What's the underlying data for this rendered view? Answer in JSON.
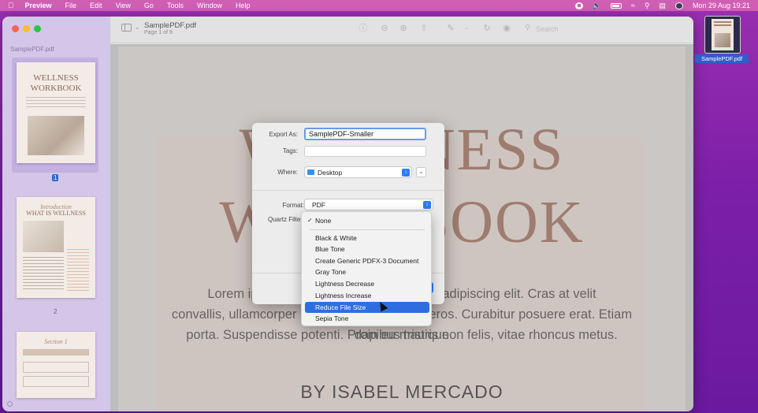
{
  "menubar": {
    "apple": "",
    "app_name": "Preview",
    "items": [
      "File",
      "Edit",
      "View",
      "Go",
      "Tools",
      "Window",
      "Help"
    ],
    "datetime": "Mon 29 Aug  19:21"
  },
  "sidebar": {
    "filename": "SamplePDF.pdf",
    "thumbnails": [
      {
        "title": "WELLNESS WORKBOOK",
        "page": "1"
      },
      {
        "title_script": "Introduction",
        "title": "WHAT IS WELLNESS",
        "page": "2"
      },
      {
        "title_script": "Section 1",
        "title": "",
        "page": ""
      }
    ]
  },
  "toolbar": {
    "title": "SamplePDF.pdf",
    "subtitle": "Page 1 of 9",
    "search_placeholder": "Search"
  },
  "document": {
    "title_line1": "WELLNESS",
    "title_line2": "WORKBOOK",
    "lorem_line1": "Lorem ipsum dolor sit amet, consectetur adipiscing elit. Cras at velit",
    "lorem_line2": "convallis, ullamcorper lacus sit amet, blandit eros. Curabitur posuere erat. Etiam dapibus tristique",
    "lorem_line3": "porta. Suspendisse potenti. Proin eu mauris non felis, vitae rhoncus metus.",
    "author": "BY ISABEL MERCADO"
  },
  "export_sheet": {
    "export_as_label": "Export As:",
    "export_as_value": "SamplePDF-Smaller",
    "tags_label": "Tags:",
    "where_label": "Where:",
    "where_value": "Desktop",
    "format_label": "Format:",
    "format_value": "PDF",
    "quartz_label": "Quartz Filter"
  },
  "quartz_menu": {
    "selected": "None",
    "items": [
      "Black & White",
      "Blue Tone",
      "Create Generic PDFX-3 Document",
      "Gray Tone",
      "Lightness Decrease",
      "Lightness Increase",
      "Reduce File Size",
      "Sepia Tone"
    ],
    "highlighted": "Reduce File Size"
  },
  "desktop": {
    "file_label": "SamplePDF.pdf"
  },
  "colors": {
    "menubar": "#cf5fb3",
    "desktop": "#8a26ac",
    "accent": "#2f6ee0",
    "title_text": "#a88476"
  }
}
